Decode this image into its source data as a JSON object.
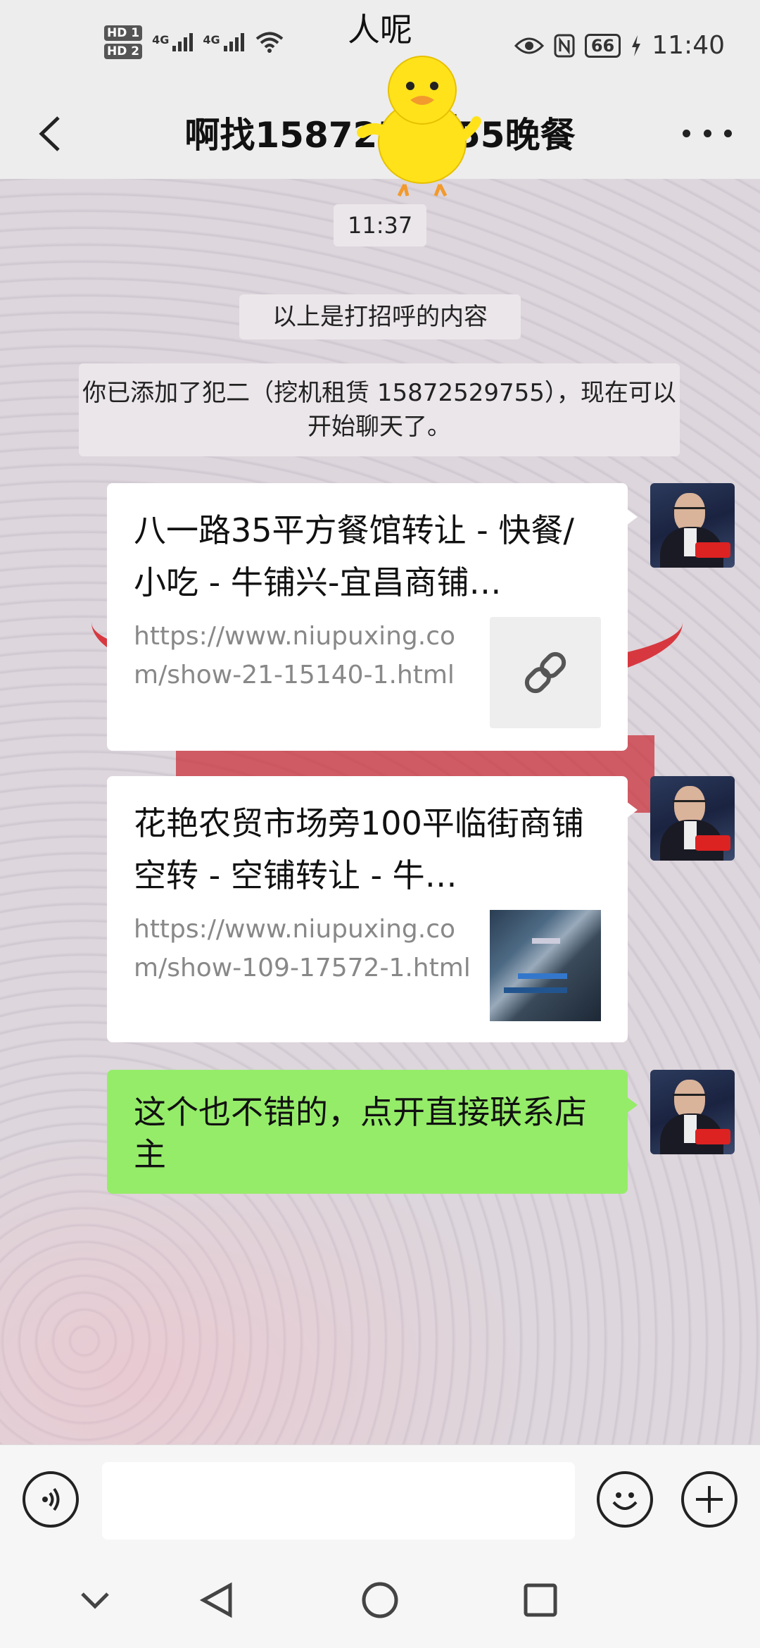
{
  "status_bar": {
    "hd1": "HD 1",
    "hd2": "HD 2",
    "net1": "4G",
    "net2": "4G",
    "center_text": "人呢",
    "battery": "66",
    "time": "11:40",
    "icons": [
      "eye-icon",
      "nfc-icon",
      "charging-icon",
      "wifi-icon"
    ]
  },
  "header": {
    "title": "啊找158725██55晚餐",
    "sticker": "duck-sticker"
  },
  "chat": {
    "timestamp": "11:37",
    "system_msg_1": "以上是打招呼的内容",
    "system_msg_2": "你已添加了犯二（挖机租赁 15872529755），现在可以开始聊天了。",
    "messages": [
      {
        "type": "link",
        "title": "八一路35平方餐馆转让 - 快餐/小吃 - 牛铺兴-宜昌商铺…",
        "url": "https://www.niupuxing.com/show-21-15140-1.html",
        "thumb": "link-icon"
      },
      {
        "type": "link",
        "title": "花艳农贸市场旁100平临街商铺空转 - 空铺转让 - 牛…",
        "url": "https://www.niupuxing.com/show-109-17572-1.html",
        "thumb": "shop-photo"
      },
      {
        "type": "text",
        "text": "这个也不错的，点开直接联系店主"
      }
    ]
  },
  "input_bar": {
    "voice": "voice-icon",
    "emoji": "emoji-icon",
    "plus": "plus-icon",
    "placeholder": ""
  },
  "colors": {
    "sent_bubble": "#95ec69",
    "bar_bg": "#ededed"
  }
}
